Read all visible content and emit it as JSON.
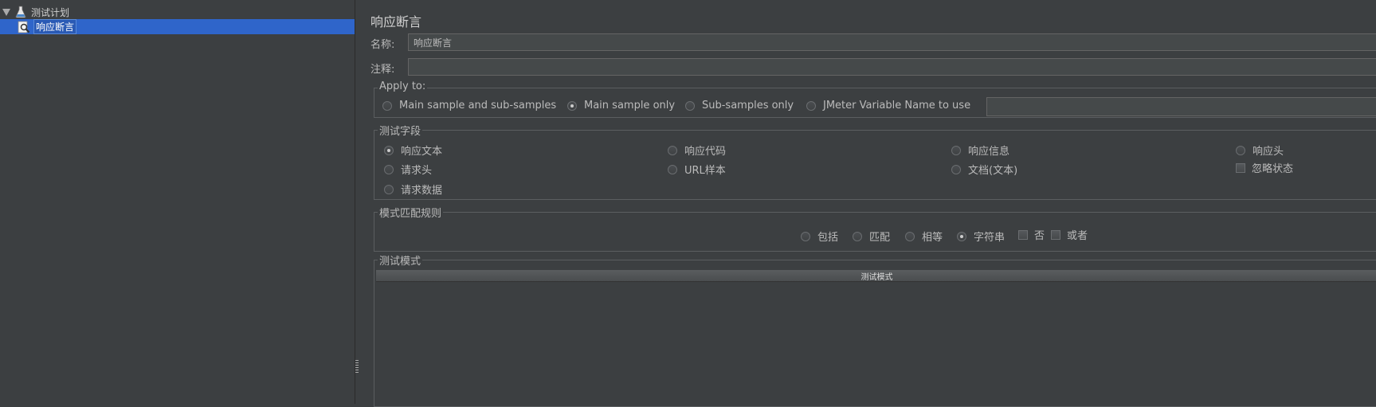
{
  "tree": {
    "root_label": "测试计划",
    "child_label": "响应断言"
  },
  "panel": {
    "title": "响应断言",
    "name_label": "名称:",
    "name_value": "响应断言",
    "comment_label": "注释:",
    "comment_value": ""
  },
  "apply_to": {
    "title": "Apply to:",
    "options": [
      {
        "label": "Main sample and sub-samples",
        "selected": false
      },
      {
        "label": "Main sample only",
        "selected": true
      },
      {
        "label": "Sub-samples only",
        "selected": false
      },
      {
        "label": "JMeter Variable Name to use",
        "selected": false
      }
    ],
    "variable_value": ""
  },
  "test_field": {
    "title": "测试字段",
    "options": [
      {
        "label": "响应文本",
        "selected": true
      },
      {
        "label": "响应代码",
        "selected": false
      },
      {
        "label": "响应信息",
        "selected": false
      },
      {
        "label": "响应头",
        "selected": false
      },
      {
        "label": "请求头",
        "selected": false
      },
      {
        "label": "URL样本",
        "selected": false
      },
      {
        "label": "文档(文本)",
        "selected": false
      },
      {
        "label": "请求数据",
        "selected": false
      }
    ],
    "ignore_status_label": "忽略状态",
    "ignore_status_checked": false
  },
  "pattern_rules": {
    "title": "模式匹配规则",
    "options": [
      {
        "label": "包括",
        "selected": false
      },
      {
        "label": "匹配",
        "selected": false
      },
      {
        "label": "相等",
        "selected": false
      },
      {
        "label": "字符串",
        "selected": true
      }
    ],
    "not_label": "否",
    "not_checked": false,
    "or_label": "或者",
    "or_checked": false
  },
  "test_patterns": {
    "title": "测试模式",
    "column_header": "测试模式",
    "rows": []
  },
  "colors": {
    "background": "#3c3f41",
    "selection": "#2f65ca",
    "text": "#bbbbbb"
  }
}
